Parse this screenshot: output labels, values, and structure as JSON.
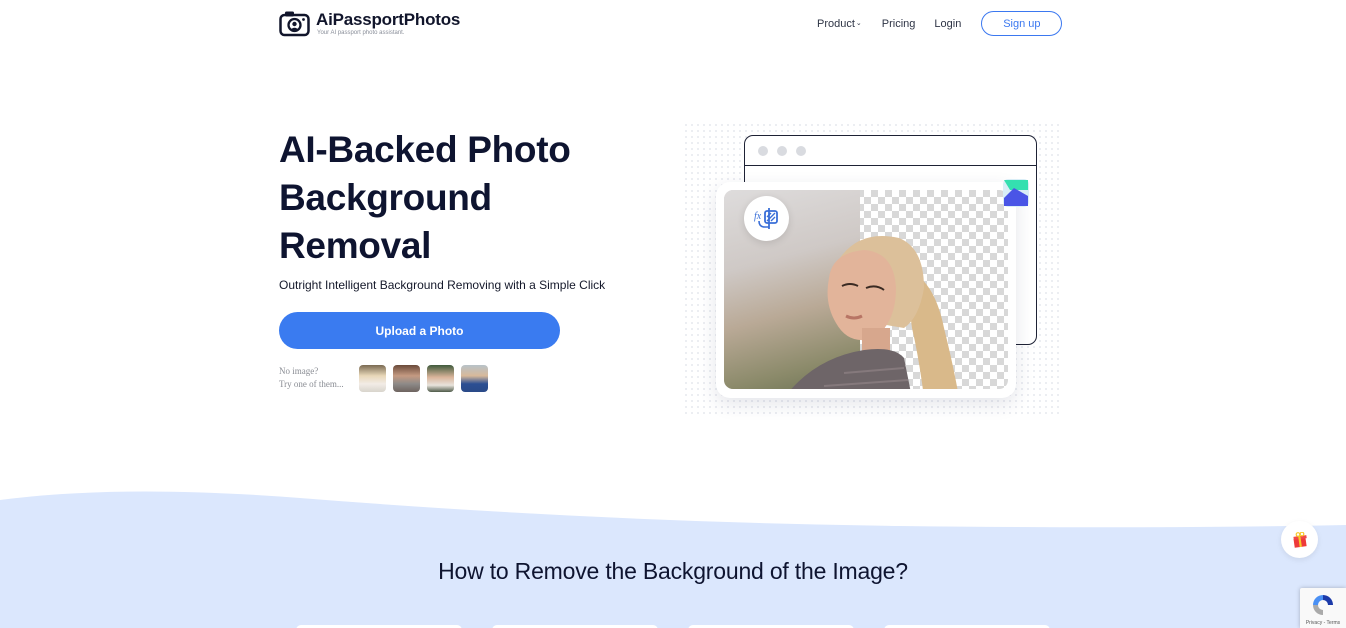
{
  "header": {
    "brand": "AiPassportPhotos",
    "tagline": "Your AI passport photo assistant.",
    "nav": [
      {
        "label": "Product",
        "has_dropdown": true
      },
      {
        "label": "Pricing"
      },
      {
        "label": "Login"
      }
    ],
    "signup_label": "Sign up"
  },
  "hero": {
    "title": "AI-Backed Photo Background Removal",
    "subtitle": "Outright Intelligent Background Removing with a Simple Click",
    "upload_label": "Upload a Photo",
    "try_line1": "No image?",
    "try_line2": "Try one of them...",
    "sample_images": [
      "sample-woman-white-top",
      "sample-woman-grey-top",
      "sample-woman-green-bg",
      "sample-man-blue-shirt"
    ]
  },
  "illustration": {
    "badge_icon": "fx-background-icon",
    "app_icon": "aipassportphotos-app-icon"
  },
  "how_section": {
    "title": "How to Remove the Background of the Image?"
  },
  "widgets": {
    "gift_icon": "gift-icon",
    "recaptcha_text": "Privacy - Terms"
  },
  "colors": {
    "accent": "#3a7bf0",
    "section_bg": "#dbe7fd",
    "text_dark": "#0e1430"
  }
}
